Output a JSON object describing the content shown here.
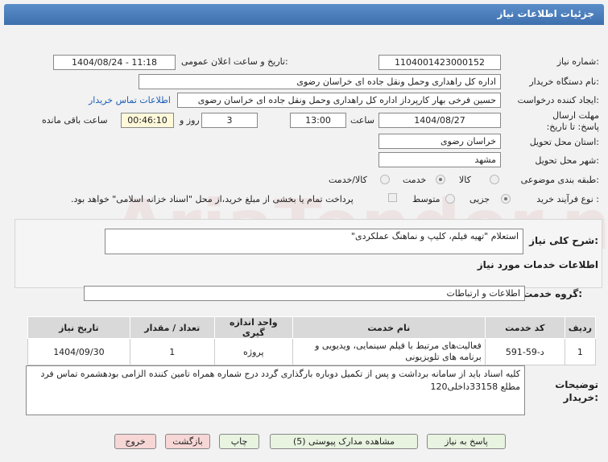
{
  "window": {
    "title": "جزئیات اطلاعات نیاز"
  },
  "fields": {
    "need_number_label": "شماره نیاز:",
    "need_number": "1104001423000152",
    "announce_label": "تاریخ و ساعت اعلان عمومی:",
    "announce_value": "1404/08/24 - 11:18",
    "buyer_label": "نام دستگاه خریدار:",
    "buyer_value": "اداره کل راهداری وحمل ونقل جاده ای خراسان رضوی",
    "creator_label": "ایجاد کننده درخواست:",
    "creator_value": "حسین فرخی بهار کارپرداز اداره کل راهداری وحمل ونقل جاده ای خراسان رضوی",
    "contact_link": "اطلاعات تماس خریدار",
    "deadline_label": "مهلت ارسال پاسخ: تا تاریخ:",
    "deadline_date": "1404/08/27",
    "time_label": "ساعت",
    "deadline_time": "13:00",
    "days_value": "3",
    "days_label": "روز و",
    "remaining_value": "00:46:10",
    "remaining_label": "ساعت باقی مانده",
    "province_label": "استان محل تحویل:",
    "province_value": "خراسان رضوی",
    "city_label": "شهر محل تحویل:",
    "city_value": "مشهد",
    "category_label": "طبقه بندی موضوعی:",
    "category_options": [
      "کالا",
      "خدمت",
      "کالا/خدمت"
    ],
    "process_label": "نوع فرآیند خرید :",
    "process_options": [
      "جزیی",
      "متوسط"
    ],
    "process_note": "پرداخت تمام یا بخشی از مبلغ خرید،از محل \"اسناد خزانه اسلامی\" خواهد بود."
  },
  "summary": {
    "label": "شرح کلی نیاز:",
    "value": "استعلام \"تهیه فیلم، کلیپ و نماهنگ عملکردی\""
  },
  "services": {
    "section_title": "اطلاعات خدمات مورد نیاز",
    "group_label": "گروه خدمت:",
    "group_value": "اطلاعات و ارتباطات",
    "headers": [
      "ردیف",
      "کد خدمت",
      "نام خدمت",
      "واحد اندازه گیری",
      "تعداد / مقدار",
      "تاریخ نیاز"
    ],
    "rows": [
      {
        "idx": "1",
        "code": "د-59-591",
        "name": "فعالیت‌های مرتبط با فیلم سینمایی، ویدیویی و برنامه های تلویزیونی",
        "unit": "پروژه",
        "qty": "1",
        "date": "1404/09/30"
      }
    ]
  },
  "notes": {
    "label": "توضیحات خریدار:",
    "value": "کلیه اسناد باید از سامانه برداشت و پس از تکمیل دوباره بارگذاری گردد درج شماره همراه تامین کننده الزامی بودهشمره تماس فرد مطلع  33158داخلی120"
  },
  "buttons": {
    "reply": "پاسخ به نیاز",
    "docs": "مشاهده مدارک پیوستی (5)",
    "print": "چاپ",
    "back": "بازگشت",
    "exit": "خروج"
  },
  "watermark": "AriaTender.net"
}
